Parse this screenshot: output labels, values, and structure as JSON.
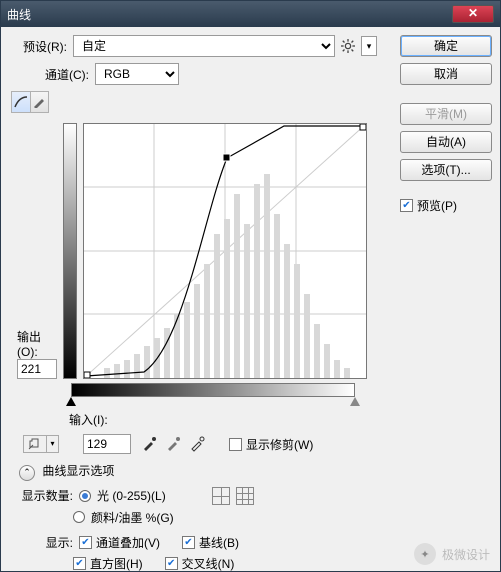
{
  "window": {
    "title": "曲线"
  },
  "preset": {
    "label": "预设(R):",
    "value": "自定"
  },
  "channel": {
    "label": "通道(C):",
    "value": "RGB"
  },
  "output": {
    "label": "输出(O):",
    "value": "221"
  },
  "input": {
    "label": "输入(I):",
    "value": "129"
  },
  "show_clipping": {
    "label": "显示修剪(W)"
  },
  "section_title": "曲线显示选项",
  "show_amount": {
    "label": "显示数量:",
    "opt_light": "光 (0-255)(L)",
    "opt_ink": "颜料/油墨 %(G)"
  },
  "show": {
    "label": "显示:",
    "overlay": "通道叠加(V)",
    "baseline": "基线(B)",
    "histogram": "直方图(H)",
    "intersect": "交叉线(N)"
  },
  "buttons": {
    "ok": "确定",
    "cancel": "取消",
    "smooth": "平滑(M)",
    "auto": "自动(A)",
    "options": "选项(T)..."
  },
  "preview": {
    "label": "预览(P)"
  },
  "watermark": "极微设计",
  "chart_data": {
    "type": "line",
    "title": "",
    "xlabel": "输入",
    "ylabel": "输出",
    "xlim": [
      0,
      255
    ],
    "ylim": [
      0,
      255
    ],
    "series": [
      {
        "name": "curve",
        "points": [
          [
            0,
            0
          ],
          [
            55,
            5
          ],
          [
            129,
            221
          ],
          [
            180,
            255
          ],
          [
            255,
            255
          ]
        ]
      }
    ],
    "control_points": [
      [
        129,
        221
      ]
    ],
    "histogram_peak_region": [
      120,
      200
    ],
    "grid": "4x4",
    "show_histogram": true,
    "show_baseline": true
  }
}
